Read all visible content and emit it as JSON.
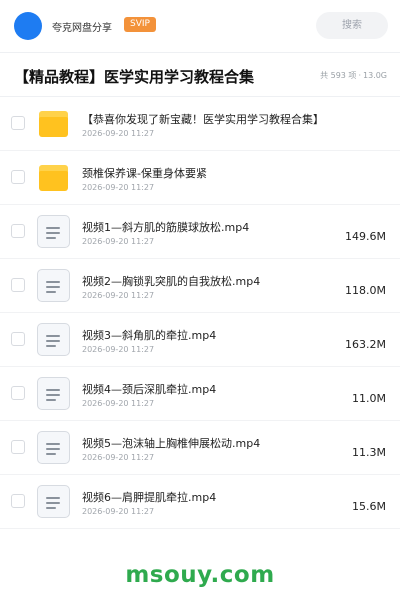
{
  "header": {
    "sharer_name": "夸克网盘分享",
    "badge": "SVIP",
    "search_label": "搜索"
  },
  "share": {
    "title": "【精品教程】医学实用学习教程合集",
    "count_text": "共 593 项",
    "size_text": "13.0G"
  },
  "files": [
    {
      "type": "folder",
      "icon": "folder-icon",
      "name": "【恭喜你发现了新宝藏！医学实用学习教程合集】",
      "date": "2026-09-20 11:27",
      "size": ""
    },
    {
      "type": "folder",
      "icon": "folder-icon",
      "name": "颈椎保养课-保重身体要紧",
      "date": "2026-09-20 11:27",
      "size": ""
    },
    {
      "type": "file",
      "icon": "document-icon",
      "name": "视频1—斜方肌的筋膜球放松.mp4",
      "date": "2026-09-20 11:27",
      "size": "149.6M"
    },
    {
      "type": "file",
      "icon": "document-icon",
      "name": "视频2—胸锁乳突肌的自我放松.mp4",
      "date": "2026-09-20 11:27",
      "size": "118.0M"
    },
    {
      "type": "file",
      "icon": "document-icon",
      "name": "视频3—斜角肌的牵拉.mp4",
      "date": "2026-09-20 11:27",
      "size": "163.2M"
    },
    {
      "type": "file",
      "icon": "document-icon",
      "name": "视频4—颈后深肌牵拉.mp4",
      "date": "2026-09-20 11:27",
      "size": "11.0M"
    },
    {
      "type": "file",
      "icon": "document-icon",
      "name": "视频5—泡沫轴上胸椎伸展松动.mp4",
      "date": "2026-09-20 11:27",
      "size": "11.3M"
    },
    {
      "type": "file",
      "icon": "document-icon",
      "name": "视频6—肩胛提肌牵拉.mp4",
      "date": "2026-09-20 11:27",
      "size": "15.6M"
    }
  ],
  "watermark": "msouy.com",
  "colors": {
    "avatar": "#1e7cf2",
    "svip_badge": "#f3923a",
    "folder": "#ffc21f",
    "watermark": "#2faa4e"
  }
}
